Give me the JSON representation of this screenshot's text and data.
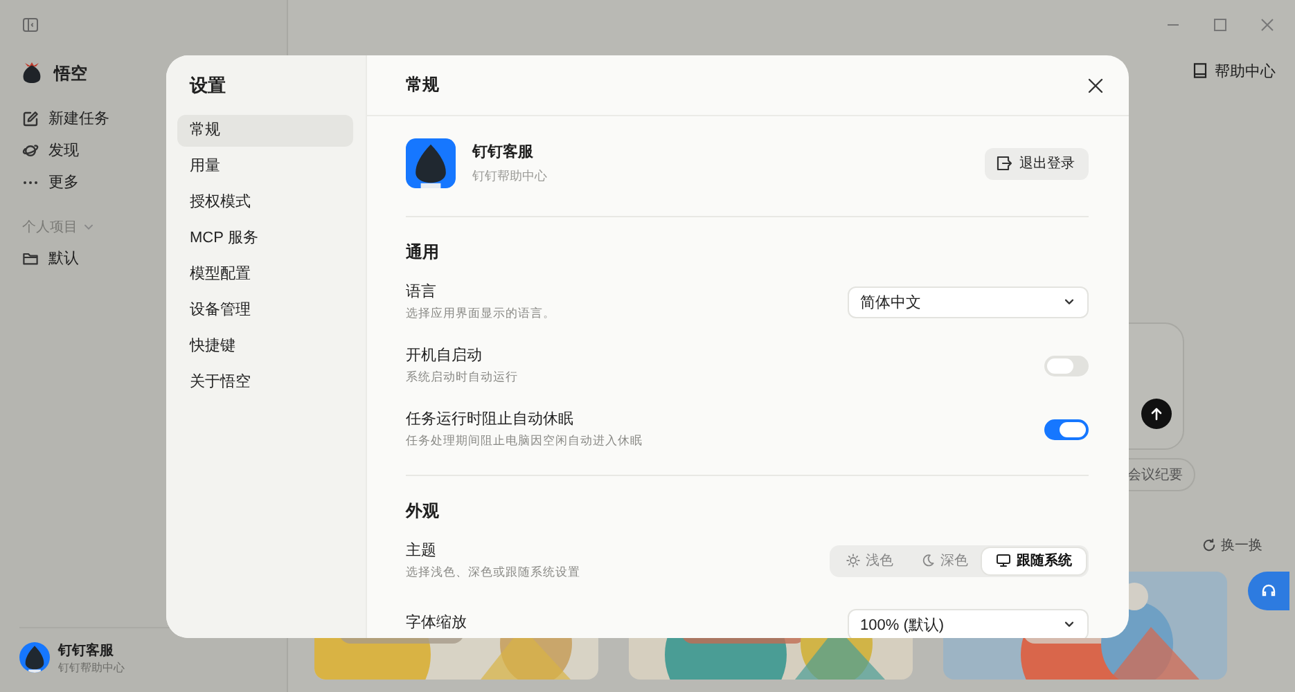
{
  "sidebar": {
    "app_name": "悟空",
    "nav": [
      {
        "kind": "compose",
        "label": "新建任务"
      },
      {
        "kind": "orbit",
        "label": "发现"
      },
      {
        "kind": "more",
        "label": "更多"
      }
    ],
    "section": {
      "label": "个人项目",
      "expanded": true
    },
    "projects": [
      {
        "label": "默认"
      }
    ],
    "user": {
      "name": "钉钉客服",
      "subtitle": "钉钉帮助中心"
    }
  },
  "main": {
    "help": "帮助中心",
    "chip": "会议纪要",
    "refresh": "换一换"
  },
  "settings": {
    "title": "设置",
    "nav": [
      {
        "label": "常规",
        "selected": true
      },
      {
        "label": "用量",
        "selected": false
      },
      {
        "label": "授权模式",
        "selected": false
      },
      {
        "label": "MCP 服务",
        "selected": false
      },
      {
        "label": "模型配置",
        "selected": false
      },
      {
        "label": "设备管理",
        "selected": false
      },
      {
        "label": "快捷键",
        "selected": false
      },
      {
        "label": "关于悟空",
        "selected": false
      }
    ],
    "page_title": "常规",
    "account": {
      "name": "钉钉客服",
      "subtitle": "钉钉帮助中心",
      "logout": "退出登录"
    },
    "sections": [
      {
        "title": "通用",
        "rows": [
          {
            "kind": "select",
            "label": "语言",
            "description": "选择应用界面显示的语言。",
            "value": "简体中文"
          },
          {
            "kind": "toggle",
            "label": "开机自启动",
            "description": "系统启动时自动运行",
            "on": false
          },
          {
            "kind": "toggle",
            "label": "任务运行时阻止自动休眠",
            "description": "任务处理期间阻止电脑因空闲自动进入休眠",
            "on": true
          }
        ]
      },
      {
        "title": "外观",
        "rows": [
          {
            "kind": "segmented",
            "label": "主题",
            "description": "选择浅色、深色或跟随系统设置",
            "options": [
              {
                "kind": "sun",
                "label": "浅色",
                "selected": false
              },
              {
                "kind": "moon",
                "label": "深色",
                "selected": false
              },
              {
                "kind": "monitor",
                "label": "跟随系统",
                "selected": true
              }
            ]
          },
          {
            "kind": "select",
            "label": "字体缩放",
            "value": "100% (默认)"
          }
        ]
      }
    ]
  }
}
